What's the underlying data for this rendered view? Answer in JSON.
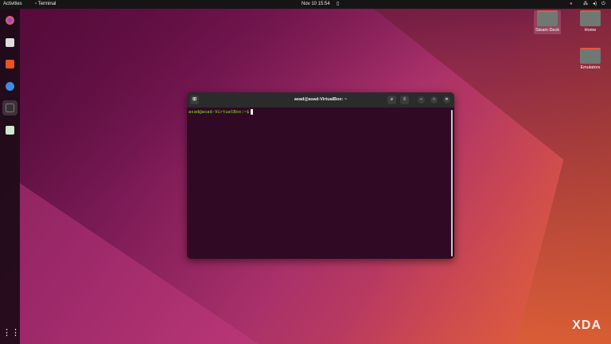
{
  "topbar": {
    "activities": "Activities",
    "app": "Terminal",
    "clock": "Nov 10  15:54"
  },
  "dock": {
    "items": [
      "Firefox",
      "Files",
      "Ubuntu Software",
      "Help",
      "Terminal",
      "Trash"
    ]
  },
  "desktop": {
    "icons": [
      "Steam Deck",
      "Home",
      "Emulators"
    ]
  },
  "terminal": {
    "title": "asad@asad-VirtualBox: ~",
    "prompt": "asad@asad-VirtualBox:~$"
  },
  "watermark": "XDA"
}
